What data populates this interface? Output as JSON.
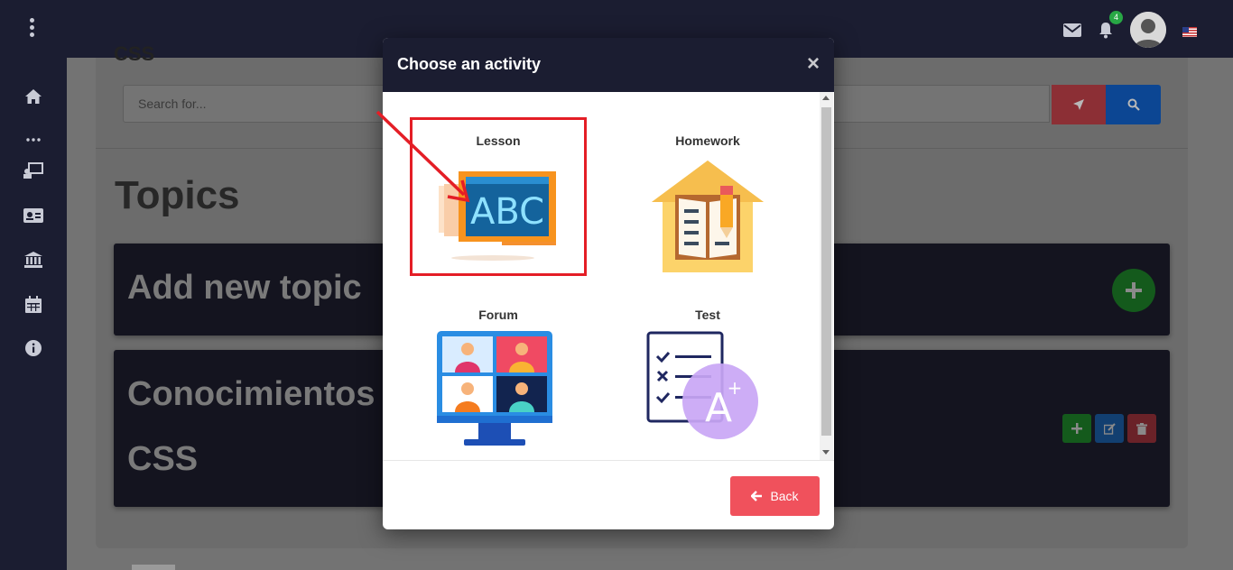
{
  "topbar": {
    "notification_count": "4",
    "icons": [
      "menu-dots-icon",
      "envelope-icon",
      "bell-icon",
      "avatar",
      "us-flag-icon"
    ]
  },
  "sidebar": {
    "icons": [
      "home-icon",
      "more-dots-icon",
      "classroom-icon",
      "id-card-icon",
      "institution-icon",
      "calendar-icon",
      "info-icon"
    ]
  },
  "page": {
    "breadcrumb_stub": "CSS",
    "search_placeholder": "Search for...",
    "title": "Topics",
    "add_topic_label": "Add new topic",
    "topic_name_line1": "Conocimientos",
    "topic_name_line2": "CSS"
  },
  "modal": {
    "title": "Choose an activity",
    "close_label": "×",
    "activities": [
      {
        "label": "Lesson",
        "icon": "abc-board-icon"
      },
      {
        "label": "Homework",
        "icon": "homework-house-book-icon"
      },
      {
        "label": "Forum",
        "icon": "video-conference-monitor-icon"
      },
      {
        "label": "Test",
        "icon": "checklist-grade-icon"
      }
    ],
    "back_label": "Back"
  },
  "colors": {
    "navbar": "#1b1d31",
    "highlight_border": "#e41e26",
    "back_button": "#f0515c",
    "add_green": "#28a745"
  }
}
